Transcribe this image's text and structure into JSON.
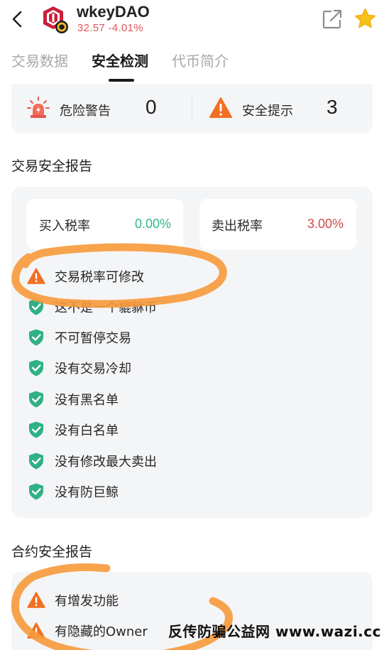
{
  "token": {
    "name": "wkeyDAO",
    "price_change": "32.57 -4.01%"
  },
  "tabs": [
    {
      "label": "交易数据",
      "active": false
    },
    {
      "label": "安全检测",
      "active": true
    },
    {
      "label": "代币简介",
      "active": false
    }
  ],
  "summary": {
    "danger_label": "危险警告",
    "danger_count": "0",
    "notice_label": "安全提示",
    "notice_count": "3"
  },
  "trade_report": {
    "title": "交易安全报告",
    "buy_tax_label": "买入税率",
    "buy_tax_value": "0.00%",
    "sell_tax_label": "卖出税率",
    "sell_tax_value": "3.00%",
    "items": [
      {
        "text": "交易税率可修改",
        "status": "warning"
      },
      {
        "text": "这不是一个貔貅币",
        "status": "safe"
      },
      {
        "text": "不可暂停交易",
        "status": "safe"
      },
      {
        "text": "没有交易冷却",
        "status": "safe"
      },
      {
        "text": "没有黑名单",
        "status": "safe"
      },
      {
        "text": "没有白名单",
        "status": "safe"
      },
      {
        "text": "没有修改最大卖出",
        "status": "safe"
      },
      {
        "text": "没有防巨鲸",
        "status": "safe"
      }
    ]
  },
  "contract_report": {
    "title": "合约安全报告",
    "items": [
      {
        "text": "有增发功能",
        "status": "warning"
      },
      {
        "text": "有隐藏的Owner",
        "status": "warning"
      }
    ]
  },
  "watermark": "反传防骗公益网 www.wazi.cc",
  "colors": {
    "accent_orange": "#f36f22",
    "safe_green": "#2fb086",
    "danger_red": "#e0555f",
    "star_yellow": "#f7c21a",
    "marker_orange": "#f79a3a"
  },
  "icons": {
    "back": "chevron-left-icon",
    "share": "share-icon",
    "favorite": "star-icon",
    "danger": "alarm-light-icon",
    "notice": "warning-triangle-icon",
    "safe": "shield-check-icon"
  }
}
